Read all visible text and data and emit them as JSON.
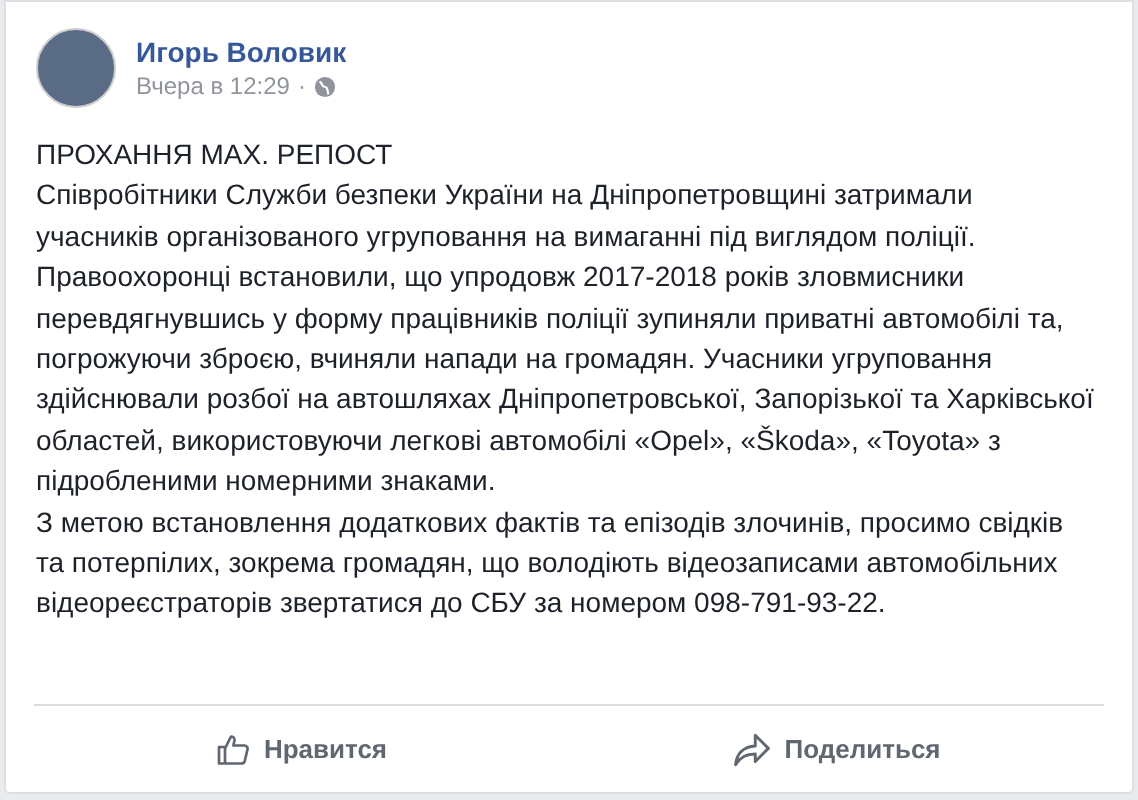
{
  "post": {
    "author": "Игорь Воловик",
    "time": "Вчера в 12:29",
    "separator": "·",
    "paragraphs": [
      "ПРОХАННЯ МАХ. РЕПОСТ",
      "Співробітники Служби безпеки України на Дніпропетровщині затримали учасників організованого угруповання на вимаганні під виглядом поліції. Правоохоронці встановили, що упродовж 2017-2018 років зловмисники перевдягнувшись у форму працівників поліції зупиняли приватні автомобілі та, погрожуючи зброєю, вчиняли напади на громадян. Учасники угруповання здійснювали розбої на автошляхах Дніпропетровської, Запорізької та Харківської областей, використовуючи легкові автомобілі «Opel», «Škoda», «Toyota» з підробленими номерними знаками.",
      "З метою встановлення додаткових фактів та епізодів злочинів, просимо свідків та потерпілих, зокрема громадян, що володіють відеозаписами автомобільних відеореєстраторів звертатися до СБУ за номером 098-791-93-22."
    ]
  },
  "actions": [
    {
      "kind": "like",
      "label": "Нравится"
    },
    {
      "kind": "share",
      "label": "Поделиться"
    }
  ]
}
